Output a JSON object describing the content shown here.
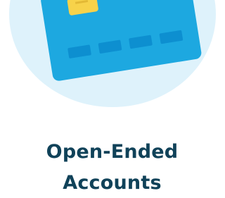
{
  "colors": {
    "circle_background": "#def2fb",
    "card_body": "#1da8e0",
    "card_stripe": "#0d8fd0",
    "chip": "#f7d24a",
    "title": "#104259"
  },
  "illustration": {
    "icon": "credit-card-icon"
  },
  "heading": {
    "line1": "Open-Ended",
    "line2": "Accounts"
  }
}
